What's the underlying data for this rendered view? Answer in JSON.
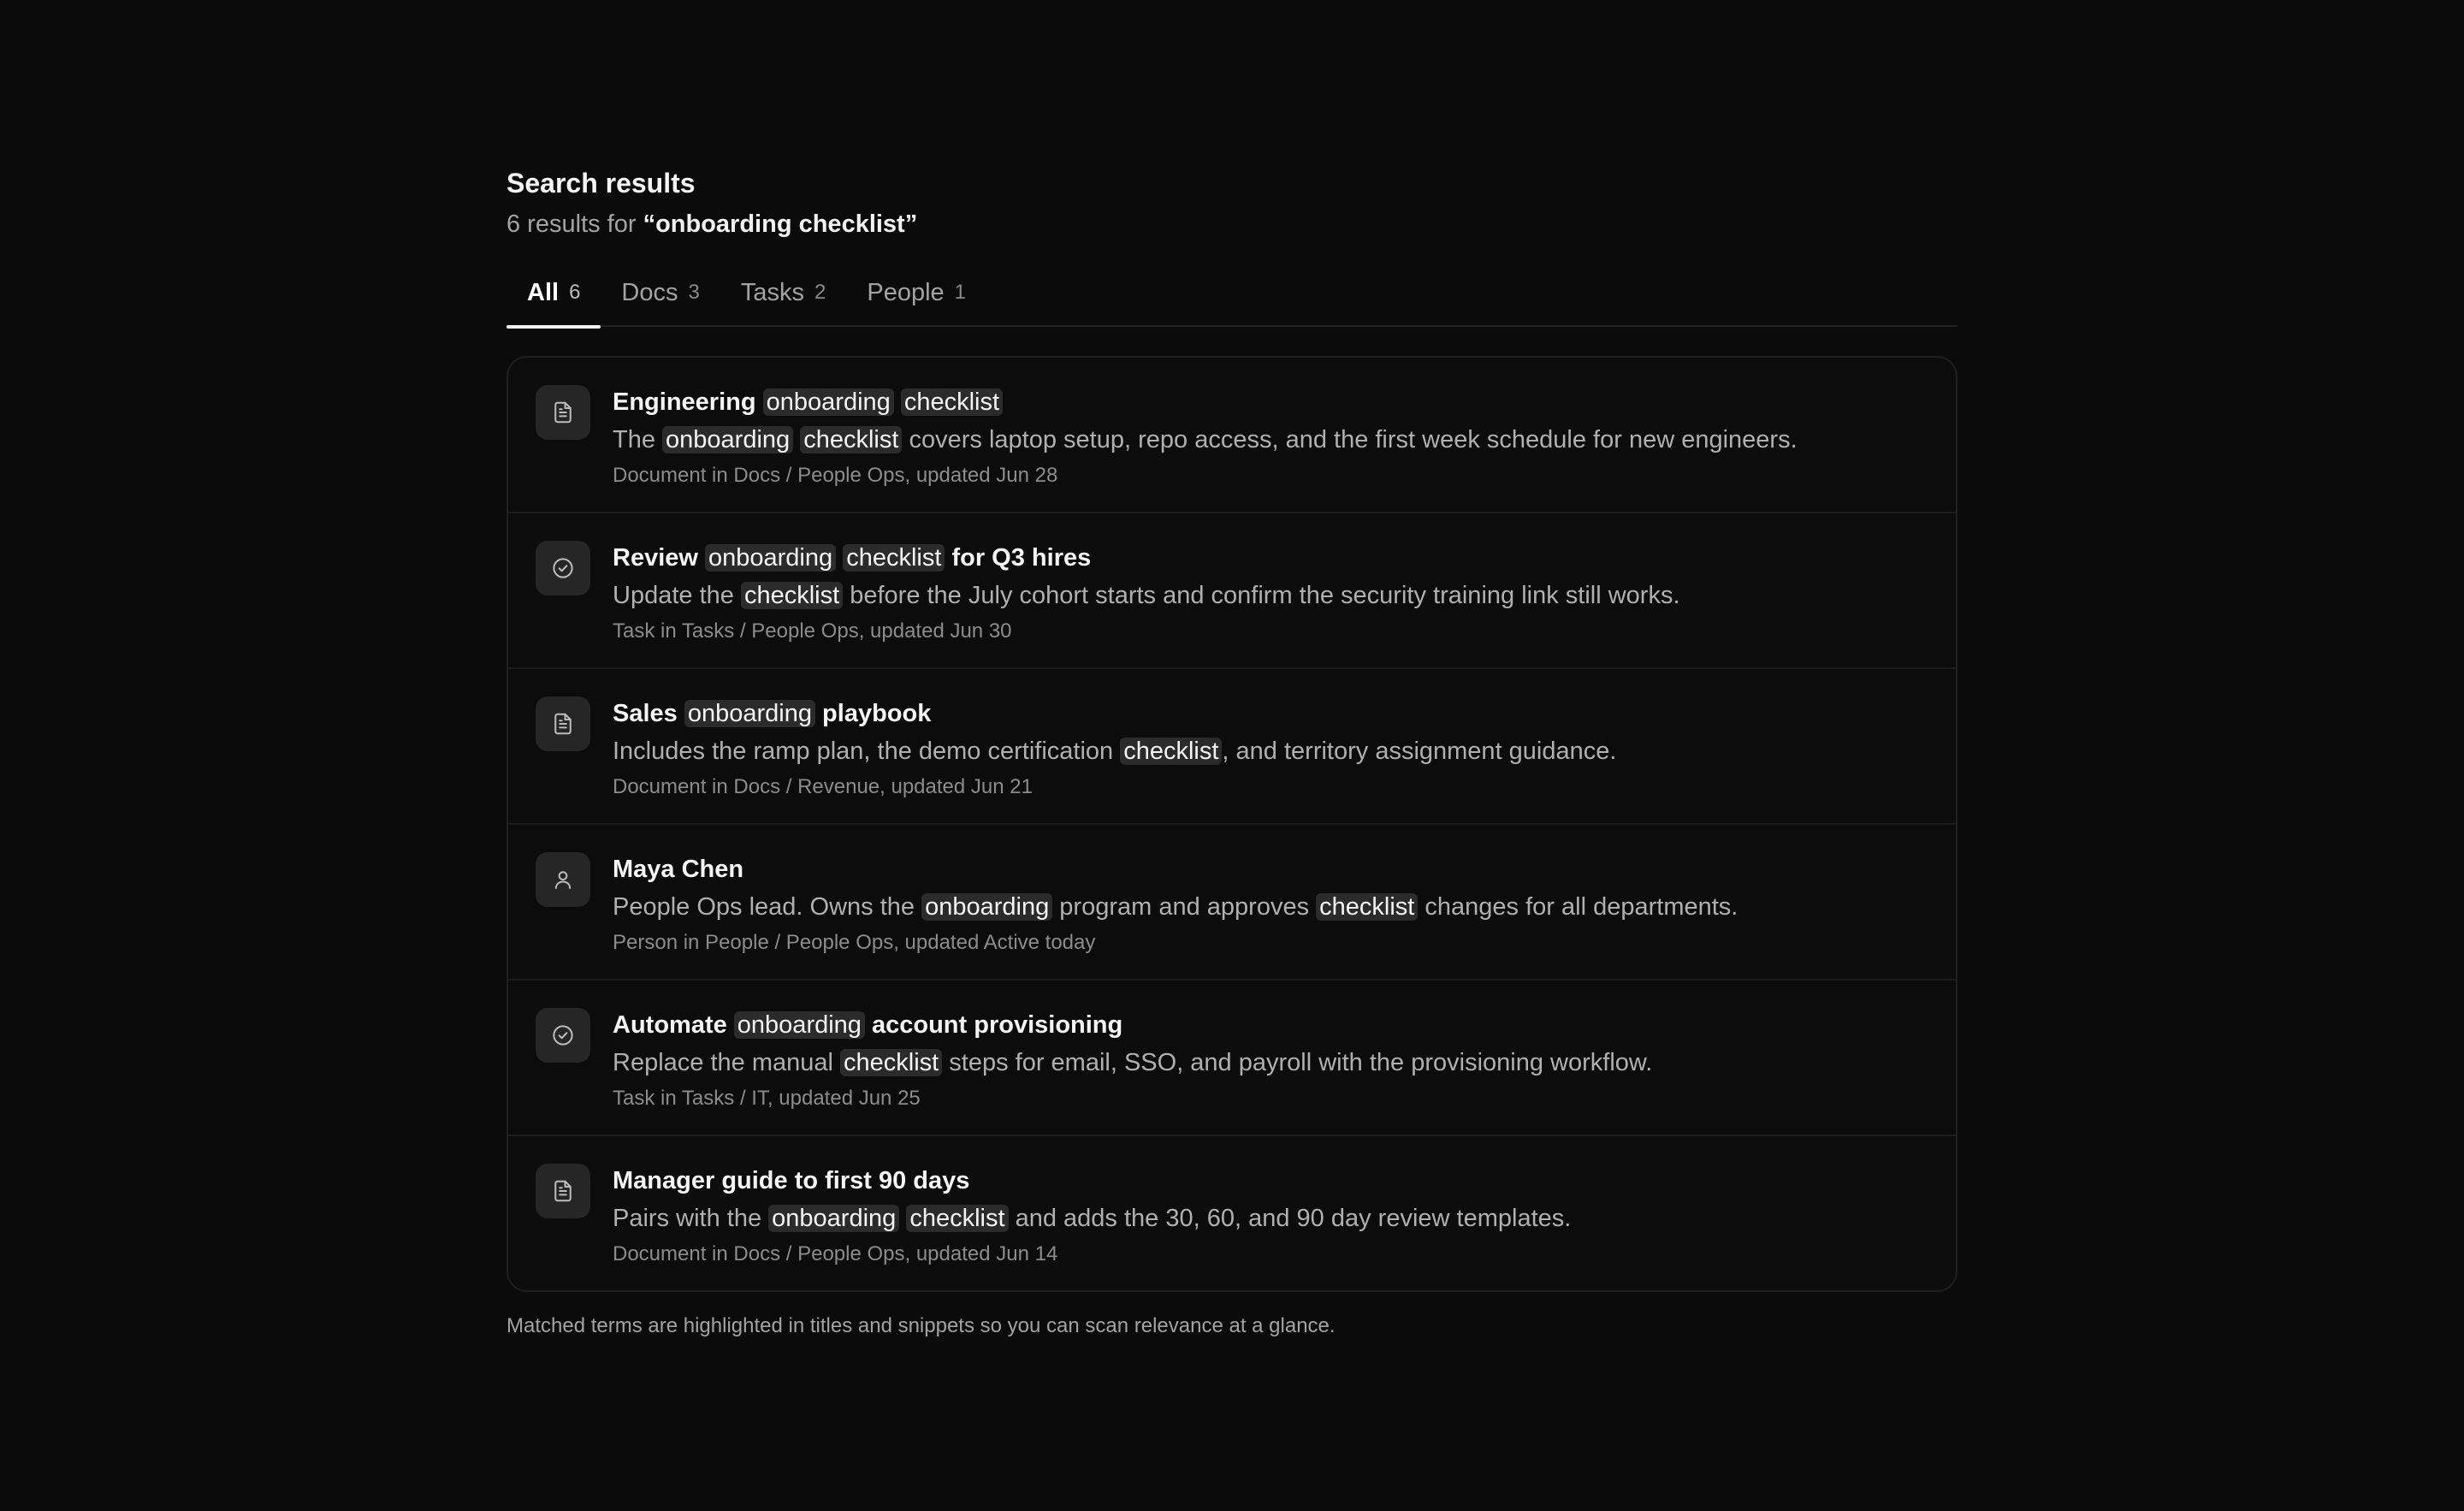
{
  "header": {
    "title": "Search results",
    "summary_prefix": "6 results for ",
    "query": "“onboarding checklist”"
  },
  "tabs": [
    {
      "label": "All",
      "count": "6",
      "active": true
    },
    {
      "label": "Docs",
      "count": "3",
      "active": false
    },
    {
      "label": "Tasks",
      "count": "2",
      "active": false
    },
    {
      "label": "People",
      "count": "1",
      "active": false
    }
  ],
  "results": [
    {
      "icon": "document-icon",
      "title": [
        {
          "t": "Engineering "
        },
        {
          "t": "onboarding",
          "hl": true
        },
        {
          "t": " "
        },
        {
          "t": "checklist",
          "hl": true
        }
      ],
      "snippet": [
        {
          "t": "The "
        },
        {
          "t": "onboarding",
          "hl": true
        },
        {
          "t": " "
        },
        {
          "t": "checklist",
          "hl": true
        },
        {
          "t": " covers laptop setup, repo access, and the first week schedule for new engineers."
        }
      ],
      "meta": "Document in Docs / People Ops, updated Jun 28"
    },
    {
      "icon": "check-circle-icon",
      "title": [
        {
          "t": "Review "
        },
        {
          "t": "onboarding",
          "hl": true
        },
        {
          "t": " "
        },
        {
          "t": "checklist",
          "hl": true
        },
        {
          "t": " for Q3 hires"
        }
      ],
      "snippet": [
        {
          "t": "Update the "
        },
        {
          "t": "checklist",
          "hl": true
        },
        {
          "t": " before the July cohort starts and confirm the security training link still works."
        }
      ],
      "meta": "Task in Tasks / People Ops, updated Jun 30"
    },
    {
      "icon": "document-icon",
      "title": [
        {
          "t": "Sales "
        },
        {
          "t": "onboarding",
          "hl": true
        },
        {
          "t": " playbook"
        }
      ],
      "snippet": [
        {
          "t": "Includes the ramp plan, the demo certification "
        },
        {
          "t": "checklist",
          "hl": true
        },
        {
          "t": ", and territory assignment guidance."
        }
      ],
      "meta": "Document in Docs / Revenue, updated Jun 21"
    },
    {
      "icon": "person-icon",
      "title": [
        {
          "t": "Maya Chen"
        }
      ],
      "snippet": [
        {
          "t": "People Ops lead. Owns the "
        },
        {
          "t": "onboarding",
          "hl": true
        },
        {
          "t": " program and approves "
        },
        {
          "t": "checklist",
          "hl": true
        },
        {
          "t": " changes for all departments."
        }
      ],
      "meta": "Person in People / People Ops, updated Active today"
    },
    {
      "icon": "check-circle-icon",
      "title": [
        {
          "t": "Automate "
        },
        {
          "t": "onboarding",
          "hl": true
        },
        {
          "t": " account provisioning"
        }
      ],
      "snippet": [
        {
          "t": "Replace the manual "
        },
        {
          "t": "checklist",
          "hl": true
        },
        {
          "t": " steps for email, SSO, and payroll with the provisioning workflow."
        }
      ],
      "meta": "Task in Tasks / IT, updated Jun 25"
    },
    {
      "icon": "document-icon",
      "title": [
        {
          "t": "Manager guide to first 90 days"
        }
      ],
      "snippet": [
        {
          "t": "Pairs with the "
        },
        {
          "t": "onboarding",
          "hl": true
        },
        {
          "t": " "
        },
        {
          "t": "checklist",
          "hl": true
        },
        {
          "t": " and adds the 30, 60, and 90 day review templates."
        }
      ],
      "meta": "Document in Docs / People Ops, updated Jun 14"
    }
  ],
  "footnote": "Matched terms are highlighted in titles and snippets so you can scan relevance at a glance."
}
